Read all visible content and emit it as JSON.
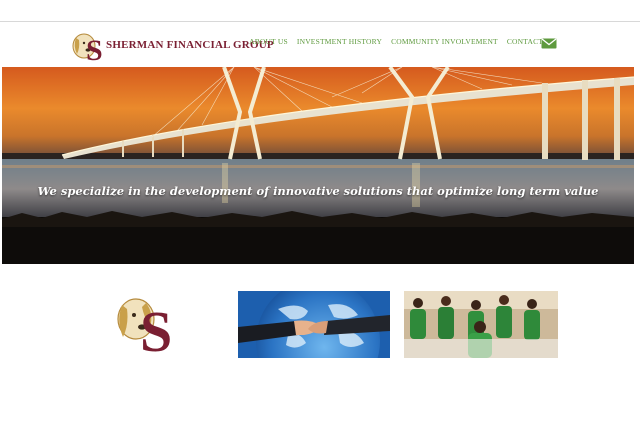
{
  "header": {
    "brand_name": "SHERMAN FINANCIAL GROUP",
    "logo_letter": "S",
    "nav": [
      {
        "label": "ABOUT US"
      },
      {
        "label": "INVESTMENT HISTORY"
      },
      {
        "label": "COMMUNITY INVOLVEMENT"
      },
      {
        "label": "CONTACT US"
      }
    ],
    "contact_icon": "mail-icon"
  },
  "hero": {
    "tagline": "We specialize in the development of innovative solutions that optimize long term value",
    "image": "bridge-at-sunset"
  },
  "tiles": [
    {
      "image": "sherman-dog-logo"
    },
    {
      "image": "handshake-over-globe"
    },
    {
      "image": "children-in-green-uniforms"
    }
  ],
  "colors": {
    "brand": "#7a1f32",
    "nav": "#5e9a3e",
    "logo_gold": "#c9a04a"
  }
}
